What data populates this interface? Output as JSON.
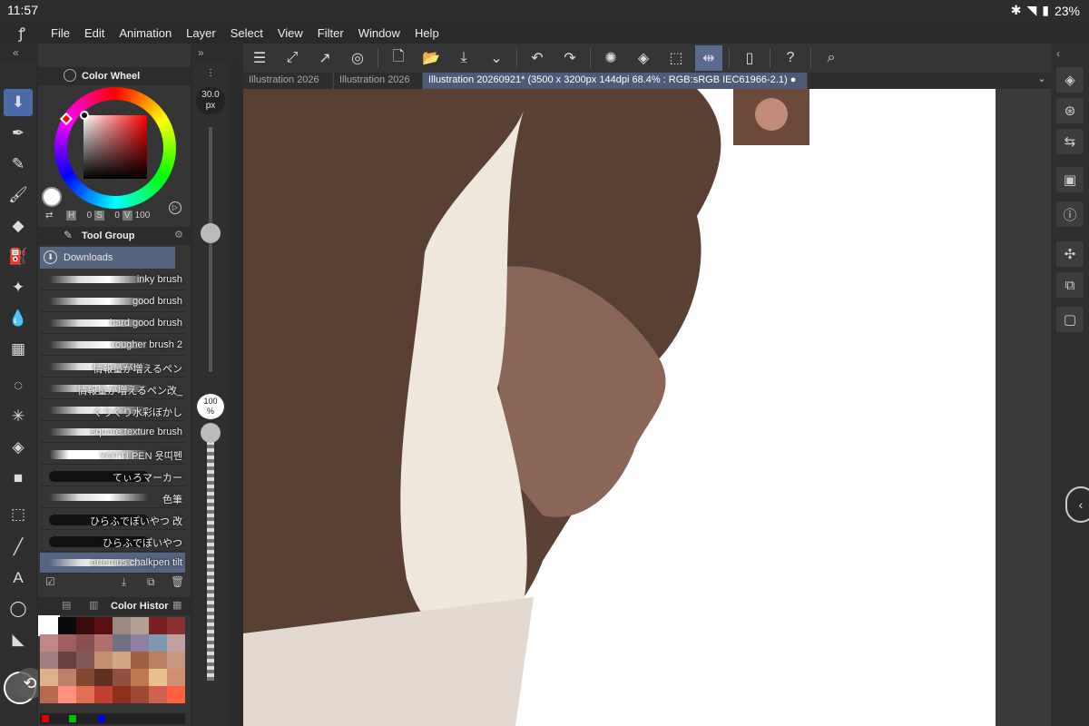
{
  "status": {
    "time": "11:57",
    "battery": "23%"
  },
  "menu": [
    "File",
    "Edit",
    "Animation",
    "Layer",
    "Select",
    "View",
    "Filter",
    "Window",
    "Help"
  ],
  "tabs": [
    "Illustration 2026",
    "Illustration 2026",
    "Illustration 20260921* (3500 x 3200px 144dpi 68.4% : RGB:sRGB IEC61966-2.1)"
  ],
  "color_wheel": {
    "title": "Color Wheel",
    "h_label": "H",
    "h": "0",
    "s_label": "S",
    "s": "0",
    "v_label": "V",
    "v": "100"
  },
  "tool_group": {
    "title": "Tool Group",
    "selected": "Downloads"
  },
  "brushes": [
    "inky brush",
    "good brush",
    "hard good brush",
    "rougher brush 2",
    "情報量が増えるペン",
    "情報量が増えるペン改_",
    "ぐりぐり水彩ぼかし",
    "square texture brush",
    "YOTTI PEN 욧띠펜",
    "てぃろマーカー",
    "色筆",
    "ひらふでぽいやつ 改",
    "ひらふでぽいやつ",
    "artemus chalkpen tilt"
  ],
  "selected_brush": "artemus chalkpen tilt",
  "brush_size": {
    "value": "30.0",
    "unit": "px"
  },
  "opacity": {
    "value": "100",
    "unit": "%"
  },
  "color_history": {
    "title": "Color Histor",
    "colors": [
      "#ffffff",
      "#0a0a0a",
      "#3a0a0a",
      "#5a1010",
      "#9c8a80",
      "#b2a095",
      "#7a2020",
      "#8a3030",
      "#c08888",
      "#a06060",
      "#885050",
      "#b07070",
      "#707080",
      "#9080a0",
      "#8098b0",
      "#c0a0a0",
      "#a08080",
      "#6a4040",
      "#805858",
      "#c09070",
      "#d0a888",
      "#a06048",
      "#b88060",
      "#c89880",
      "#e0b088",
      "#c08068",
      "#804830",
      "#603020",
      "#905040",
      "#c07850",
      "#e8c090",
      "#d09070",
      "#b86850",
      "#ff9080",
      "#e07050",
      "#c04030",
      "#903020",
      "#a04838",
      "#d06050",
      "#ff6040"
    ]
  }
}
